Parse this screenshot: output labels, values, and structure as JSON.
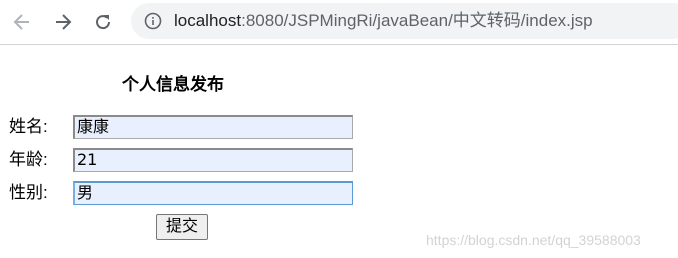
{
  "browser": {
    "url_host": "localhost",
    "url_rest": ":8080/JSPMingRi/javaBean/中文转码/index.jsp",
    "icons": {
      "back": "back-arrow-icon",
      "forward": "forward-arrow-icon",
      "reload": "reload-icon",
      "site_info": "info-icon"
    }
  },
  "form": {
    "title": "个人信息发布",
    "fields": [
      {
        "label": "姓名:",
        "value": "康康"
      },
      {
        "label": "年龄:",
        "value": "21"
      },
      {
        "label": "性别:",
        "value": "男"
      }
    ],
    "submit_label": "提交"
  },
  "watermark": "https://blog.csdn.net/qq_39588003",
  "colors": {
    "input_autofill_bg": "#e8f0fe",
    "focus_border": "#5a9bd5"
  }
}
